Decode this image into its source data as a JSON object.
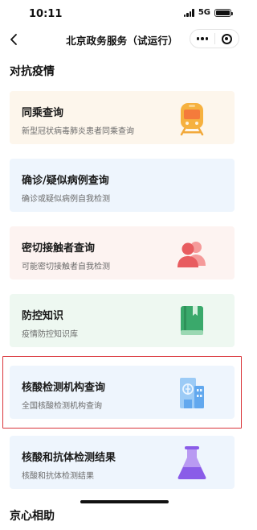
{
  "status_bar": {
    "time": "10:11",
    "network": "5G"
  },
  "nav": {
    "back_icon": "chevron-left-icon",
    "title": "北京政务服务（试运行）",
    "more_icon": "more-dots-icon",
    "close_icon": "target-circle-icon"
  },
  "sections": [
    {
      "title": "对抗疫情"
    },
    {
      "title": "京心相助"
    }
  ],
  "cards": [
    {
      "title": "同乘查询",
      "subtitle": "新型冠状病毒肺炎患者同乘查询",
      "icon": "train-icon",
      "bg": "#fdf6ec"
    },
    {
      "title": "确诊/疑似病例查询",
      "subtitle": "确诊或疑似病例自我检测",
      "icon": "",
      "bg": "#eef5fd"
    },
    {
      "title": "密切接触者查询",
      "subtitle": "可能密切接触者自我检测",
      "icon": "people-icon",
      "bg": "#fdf3f1"
    },
    {
      "title": "防控知识",
      "subtitle": "疫情防控知识库",
      "icon": "book-icon",
      "bg": "#eef8f1"
    },
    {
      "title": "核酸检测机构查询",
      "subtitle": "全国核酸检测机构查询",
      "icon": "hospital-building-icon",
      "bg": "#eef5fd"
    },
    {
      "title": "核酸和抗体检测结果",
      "subtitle": "核酸和抗体检测结果",
      "icon": "flask-icon",
      "bg": "#eef5fd"
    }
  ],
  "colors": {
    "highlight_border": "#d9343a",
    "train": "#f2a93b",
    "people": "#e85c60",
    "book": "#3aa96b",
    "hospital": "#62a8ee",
    "flask": "#8a5ce8"
  }
}
